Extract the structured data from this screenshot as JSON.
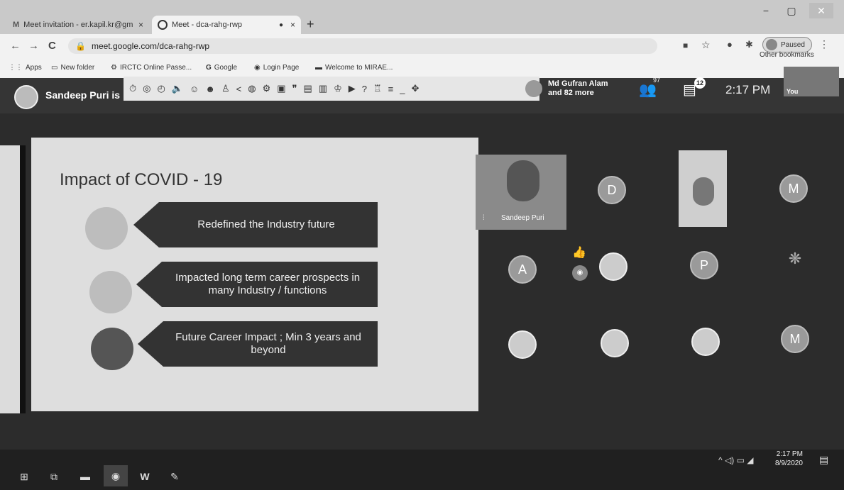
{
  "browser": {
    "tabs": [
      {
        "title": "Meet invitation - er.kapil.kr@gm",
        "favicon": "gmail-icon",
        "close": "×"
      },
      {
        "title": "Meet - dca-rahg-rwp",
        "favicon": "meet-icon",
        "close": "×",
        "recording_dot": "●"
      }
    ],
    "new_tab": "+",
    "window_controls": {
      "minimize": "−",
      "maximize": "▢",
      "close": "✕"
    },
    "nav": {
      "back": "←",
      "forward": "→",
      "reload": "C"
    },
    "url": "meet.google.com/dca-rahg-rwp",
    "profile_status": "Paused",
    "menu": "⋮",
    "bookmarks": [
      {
        "label": "Apps",
        "icon": "apps-grid-icon"
      },
      {
        "label": "New folder",
        "icon": "folder-icon"
      },
      {
        "label": "IRCTC Online Passe...",
        "icon": "irctc-icon"
      },
      {
        "label": "Google",
        "icon": "google-icon"
      },
      {
        "label": "Login Page",
        "icon": "globe-icon"
      },
      {
        "label": "Welcome to MIRAE...",
        "icon": "mirae-icon"
      }
    ],
    "other_bookmarks": "Other bookmarks"
  },
  "meet": {
    "presenter_banner": "Sandeep Puri is",
    "others_text_line1": "Md Gufran Alam",
    "others_text_line2": "and 82 more",
    "people_count": "97",
    "chat_count": "12",
    "time": "2:17 PM",
    "self_label": "You",
    "participants": [
      {
        "type": "video",
        "name": "Sandeep Puri"
      },
      {
        "type": "initial",
        "initial": "D"
      },
      {
        "type": "video",
        "name": ""
      },
      {
        "type": "initial",
        "initial": "M"
      },
      {
        "type": "initial",
        "initial": "A"
      },
      {
        "type": "photo"
      },
      {
        "type": "initial",
        "initial": "P"
      },
      {
        "type": "initial",
        "initial": "M"
      }
    ]
  },
  "slide": {
    "title": "Impact of COVID - 19",
    "points": [
      {
        "text": "Redefined the Industry future"
      },
      {
        "text": "Impacted long term career prospects in many Industry / functions"
      },
      {
        "text": "Future Career Impact ; Min 3 years and beyond"
      }
    ]
  },
  "taskbar": {
    "time": "2:17 PM",
    "date": "8/9/2020",
    "apps": [
      "windows-start-icon",
      "task-view-icon",
      "file-explorer-icon",
      "chrome-icon",
      "word-icon",
      "paint-icon"
    ]
  },
  "colors": {
    "meet_bg": "#2c2c2c",
    "slide_bg": "#dedede",
    "arrow": "#333333",
    "circle_light": "#bdbdbd",
    "circle_dark": "#555555"
  }
}
